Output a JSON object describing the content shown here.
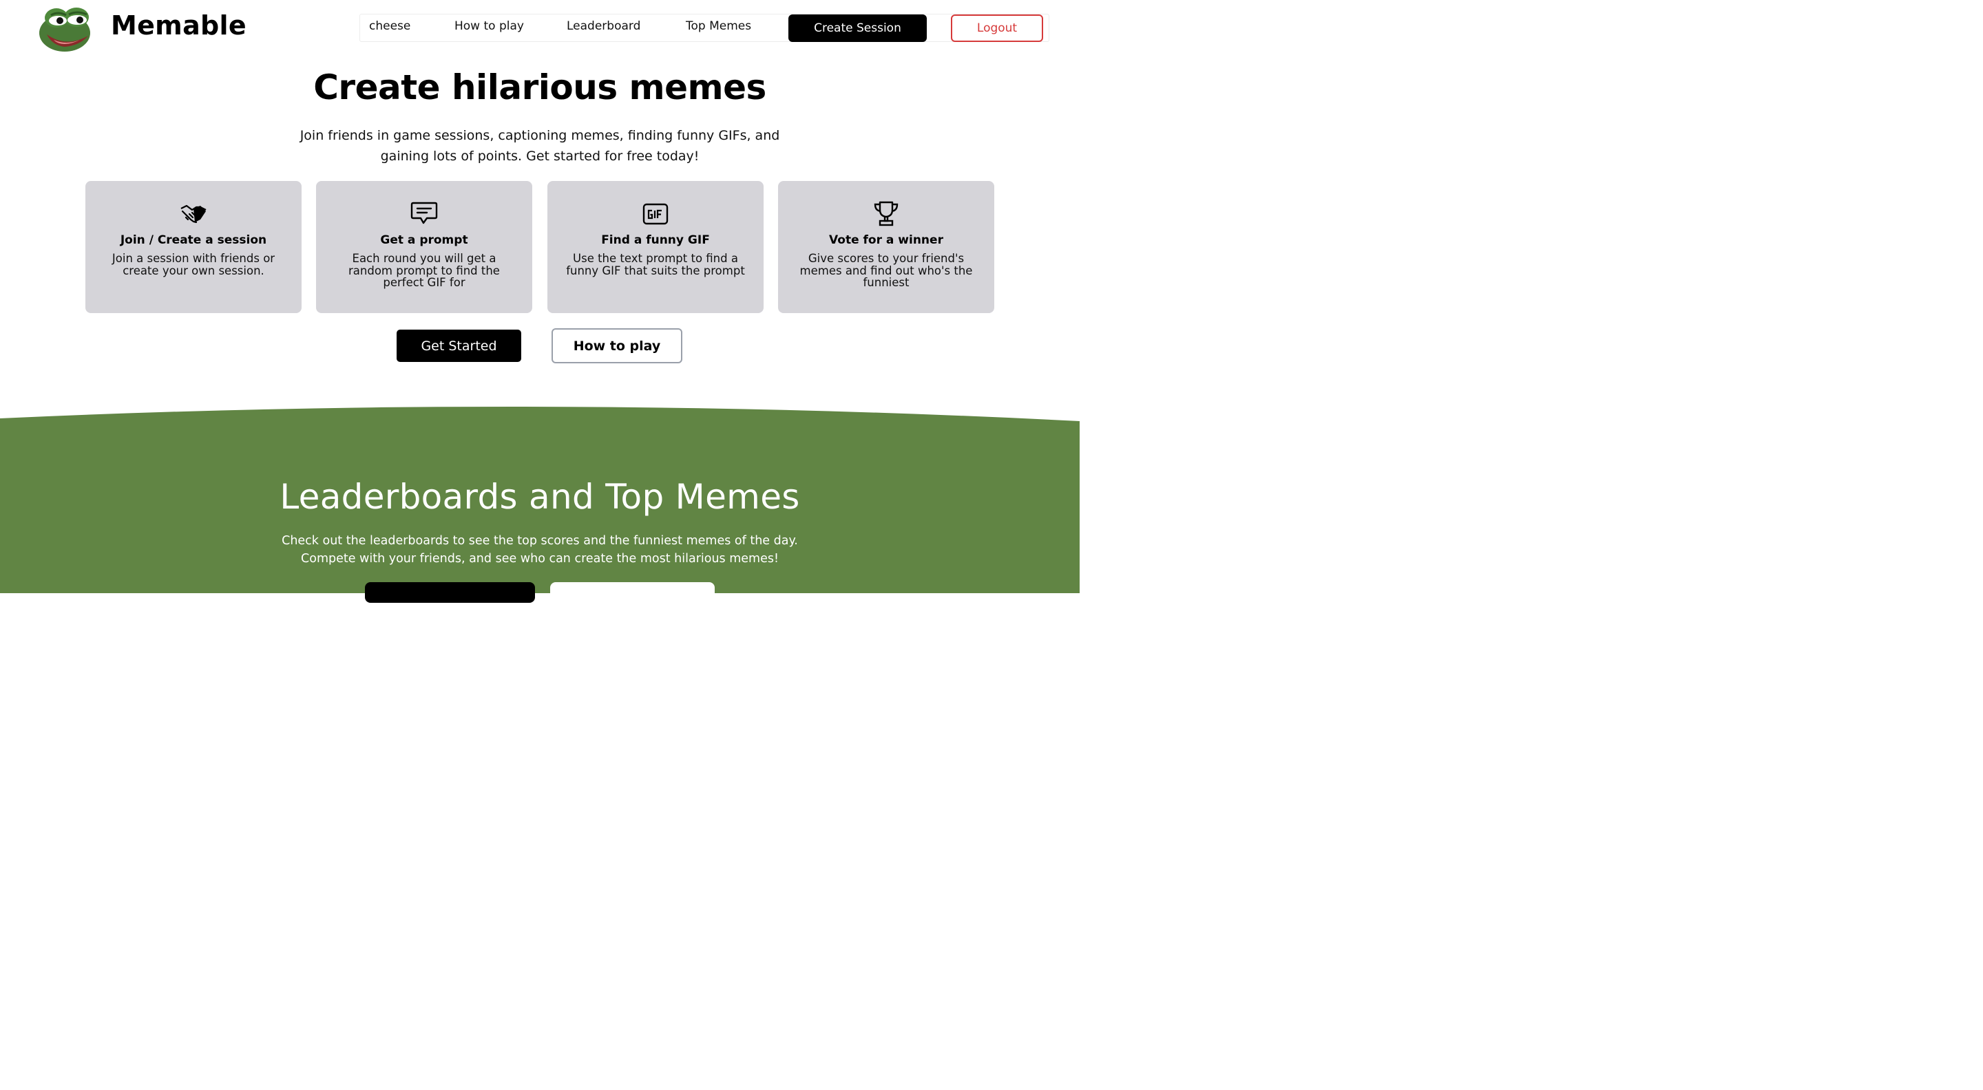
{
  "header": {
    "brand": "Memable",
    "nav": {
      "user": "cheese",
      "how_to_play": "How to play",
      "leaderboard": "Leaderboard",
      "top_memes": "Top Memes",
      "create_session": "Create Session",
      "logout": "Logout"
    }
  },
  "hero": {
    "title": "Create hilarious memes",
    "subtitle_line1": "Join friends in game sessions, captioning memes, finding funny GIFs, and",
    "subtitle_line2": "gaining lots of points. Get started for free today!"
  },
  "features": [
    {
      "icon": "handshake-icon",
      "title": "Join / Create a session",
      "desc": "Join a session with friends or create your own session."
    },
    {
      "icon": "chat-bubble-icon",
      "title": "Get a prompt",
      "desc": "Each round you will get a random prompt to find the perfect GIF for"
    },
    {
      "icon": "gif-icon",
      "title": "Find a funny GIF",
      "desc": "Use the text prompt to find a funny GIF that suits the prompt"
    },
    {
      "icon": "trophy-icon",
      "title": "Vote for a winner",
      "desc": "Give scores to your friend's memes and find out who's the funniest"
    }
  ],
  "actions": {
    "get_started": "Get Started",
    "how_to_play": "How to play"
  },
  "leaderboards": {
    "title": "Leaderboards and Top Memes",
    "subtitle_line1": "Check out the leaderboards to see the top scores and the funniest memes of the day.",
    "subtitle_line2": "Compete with your friends, and see who can create the most hilarious memes!"
  },
  "colors": {
    "accent_green": "#618544",
    "card_gray": "#d5d4d9",
    "logout_red": "#d63a3a"
  }
}
